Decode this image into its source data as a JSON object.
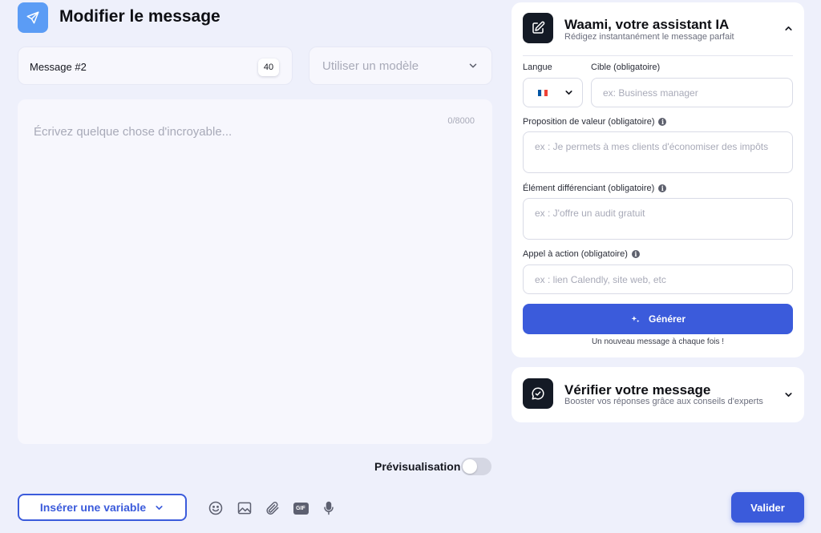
{
  "header": {
    "title": "Modifier le message"
  },
  "message": {
    "name_value": "Message #2",
    "name_char_count": "40",
    "template_placeholder": "Utiliser un modèle",
    "body_placeholder": "Écrivez quelque chose d'incroyable...",
    "body_counter": "0/8000"
  },
  "preview": {
    "label": "Prévisualisation",
    "enabled": false
  },
  "toolbar": {
    "insert_variable_label": "Insérer une variable",
    "icons": [
      "smiley-icon",
      "image-icon",
      "paperclip-icon",
      "gif-icon",
      "microphone-icon"
    ],
    "gif_label": "GIF",
    "validate_label": "Valider"
  },
  "ai_assistant": {
    "title": "Waami, votre assistant IA",
    "subtitle": "Rédigez instantanément le message parfait",
    "language_label": "Langue",
    "language_flag_colors": [
      "#0055a4",
      "#ffffff",
      "#ef4135"
    ],
    "target_label": "Cible (obligatoire)",
    "target_placeholder": "ex: Business manager",
    "value_prop_label": "Proposition de valeur (obligatoire)",
    "value_prop_placeholder": "ex : Je permets à mes clients d'économiser des impôts",
    "differentiator_label": "Élément différenciant (obligatoire)",
    "differentiator_placeholder": "ex : J'offre un audit gratuit",
    "cta_label": "Appel à action (obligatoire)",
    "cta_placeholder": "ex : lien Calendly, site web, etc",
    "generate_label": "Générer",
    "generate_note": "Un nouveau message à chaque fois !"
  },
  "verify": {
    "title": "Vérifier votre message",
    "subtitle": "Booster vos réponses grâce aux conseils d'experts"
  },
  "colors": {
    "accent": "#3b5bdb",
    "header_icon_bg": "#5b9cf5",
    "panel_icon_bg": "#141a25",
    "page_bg": "#eef0fb"
  }
}
